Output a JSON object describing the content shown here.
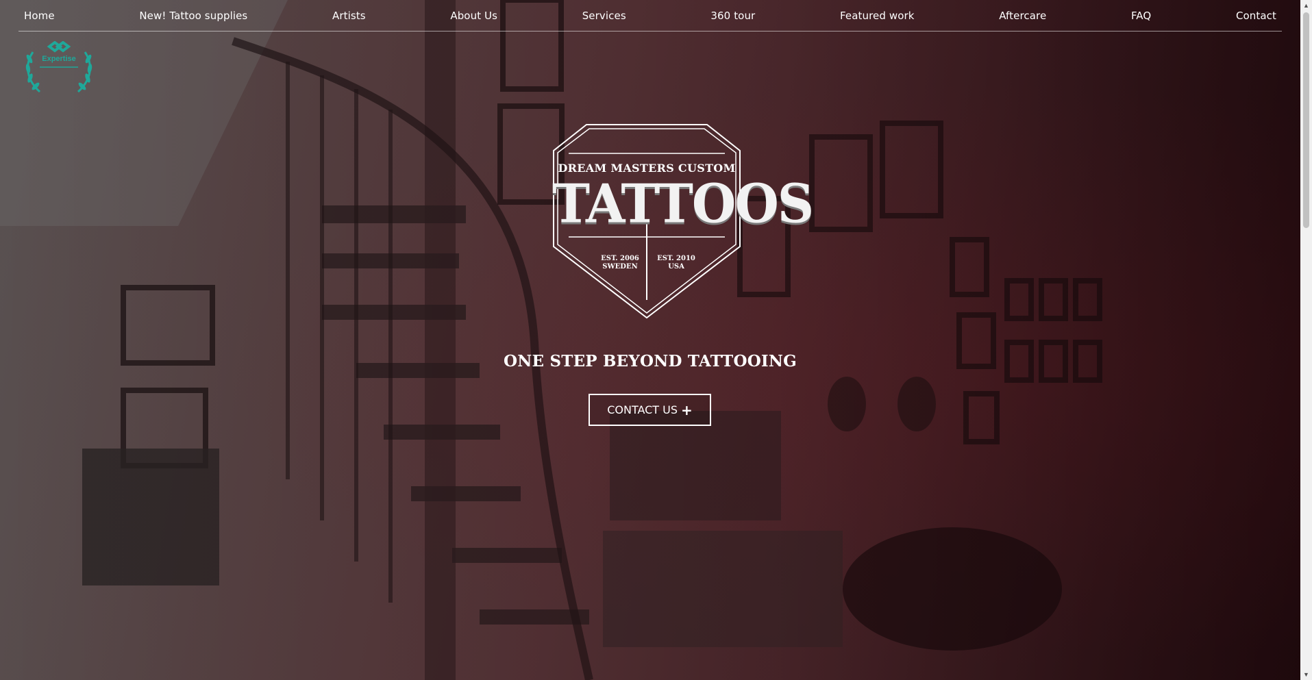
{
  "nav": {
    "items": [
      {
        "label": "Home"
      },
      {
        "label": "New! Tattoo supplies"
      },
      {
        "label": "Artists"
      },
      {
        "label": "About Us"
      },
      {
        "label": "Services"
      },
      {
        "label": "360 tour"
      },
      {
        "label": "Featured work"
      },
      {
        "label": "Aftercare"
      },
      {
        "label": "FAQ"
      },
      {
        "label": "Contact"
      }
    ]
  },
  "badge": {
    "label": "Expertise",
    "icon": "laurel-award-icon",
    "color": "#1fa89a"
  },
  "logo": {
    "top_text": "DREAM MASTERS CUSTOM",
    "main_text": "TATTOOS",
    "est_left_line1": "EST. 2006",
    "est_left_line2": "SWEDEN",
    "est_right_line1": "EST. 2010",
    "est_right_line2": "USA"
  },
  "hero": {
    "tagline": "ONE STEP BEYOND TATTOOING",
    "cta_label": "CONTACT US",
    "cta_icon": "plus-icon"
  },
  "colors": {
    "background": "#4a2a2e",
    "text": "#ffffff",
    "accent": "#1fa89a"
  }
}
